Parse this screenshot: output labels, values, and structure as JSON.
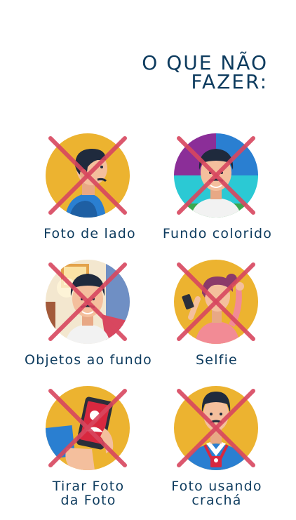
{
  "title": {
    "line1": "O QUE NÃO",
    "line2": "FAZER:"
  },
  "items": [
    {
      "label_lines": [
        "Foto de lado"
      ],
      "icon": "side-profile-photo-icon"
    },
    {
      "label_lines": [
        "Fundo colorido"
      ],
      "icon": "colored-background-icon"
    },
    {
      "label_lines": [
        "Objetos ao fundo"
      ],
      "icon": "background-objects-icon"
    },
    {
      "label_lines": [
        "Selfie"
      ],
      "icon": "selfie-icon"
    },
    {
      "label_lines": [
        "Tirar Foto",
        "da Foto"
      ],
      "icon": "photo-of-photo-icon"
    },
    {
      "label_lines": [
        "Foto usando",
        "crachá"
      ],
      "icon": "badge-photo-icon"
    }
  ],
  "colors": {
    "title": "#0d3b5e",
    "circle_bg": "#ecb330",
    "cross": "#d8475f",
    "skin": "#f4bf9d",
    "hair": "#1f2a3d",
    "shirt": "#2a7fd1"
  }
}
